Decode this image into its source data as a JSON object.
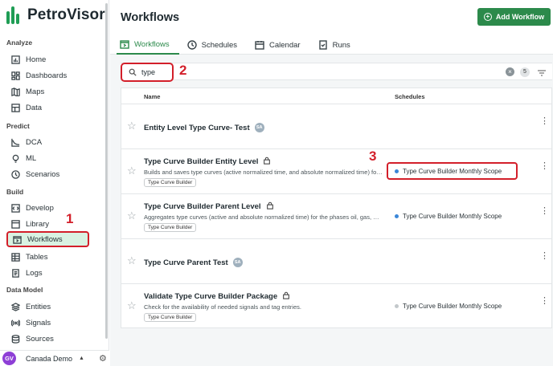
{
  "app": {
    "name": "PetroVisor",
    "brand_color": "#2c8a4b",
    "highlight_color": "#d31f2a"
  },
  "sidebar": {
    "sections": [
      {
        "label": "Analyze",
        "items": [
          {
            "label": "Home",
            "icon": "chart-icon"
          },
          {
            "label": "Dashboards",
            "icon": "dashboard-icon"
          },
          {
            "label": "Maps",
            "icon": "map-icon"
          },
          {
            "label": "Data",
            "icon": "table-icon"
          }
        ]
      },
      {
        "label": "Predict",
        "items": [
          {
            "label": "DCA",
            "icon": "curve-icon"
          },
          {
            "label": "ML",
            "icon": "lightbulb-icon"
          },
          {
            "label": "Scenarios",
            "icon": "scenario-icon"
          }
        ]
      },
      {
        "label": "Build",
        "items": [
          {
            "label": "Develop",
            "icon": "code-icon"
          },
          {
            "label": "Library",
            "icon": "library-icon"
          },
          {
            "label": "Workflows",
            "icon": "workflow-icon",
            "active": true
          },
          {
            "label": "Tables",
            "icon": "grid-icon"
          },
          {
            "label": "Logs",
            "icon": "log-icon"
          }
        ]
      },
      {
        "label": "Data Model",
        "items": [
          {
            "label": "Entities",
            "icon": "layers-icon"
          },
          {
            "label": "Signals",
            "icon": "signal-icon"
          },
          {
            "label": "Sources",
            "icon": "database-icon"
          }
        ]
      }
    ],
    "footer": {
      "avatar_initials": "GV",
      "workspace": "Canada Demo"
    }
  },
  "header": {
    "title": "Workflows",
    "add_button": "Add Workflow",
    "tabs": [
      {
        "label": "Workflows",
        "active": true
      },
      {
        "label": "Schedules"
      },
      {
        "label": "Calendar"
      },
      {
        "label": "Runs"
      }
    ]
  },
  "search": {
    "value": "type",
    "result_count": "5"
  },
  "table": {
    "columns": {
      "name": "Name",
      "schedules": "Schedules"
    },
    "rows": [
      {
        "name": "Entity Level Type Curve- Test",
        "badge": "SA",
        "description": "",
        "tag": "",
        "schedule": ""
      },
      {
        "name": "Type Curve Builder Entity Level",
        "locked": true,
        "description": "Builds and saves type curves (active normalized time, and absolute normalized time) for the phases oil, gas, water, a...",
        "tag": "Type Curve Builder",
        "schedule": "Type Curve Builder Monthly Scope",
        "schedule_active": true
      },
      {
        "name": "Type Curve Builder Parent Level",
        "locked": true,
        "description": "Aggregates type curves (active and absolute normalized time) for the phases oil, gas, water, a...",
        "tag": "Type Curve Builder",
        "schedule": "Type Curve Builder Monthly Scope",
        "schedule_active": true
      },
      {
        "name": "Type Curve Parent Test",
        "badge": "SA",
        "description": "",
        "tag": "",
        "schedule": ""
      },
      {
        "name": "Validate Type Curve Builder Package",
        "locked": true,
        "description": "Check for the availability of needed signals and tag entries.",
        "tag": "Type Curve Builder",
        "schedule": "Type Curve Builder Monthly Scope",
        "schedule_active": false
      }
    ]
  },
  "annotations": {
    "one": "1",
    "two": "2",
    "three": "3"
  }
}
